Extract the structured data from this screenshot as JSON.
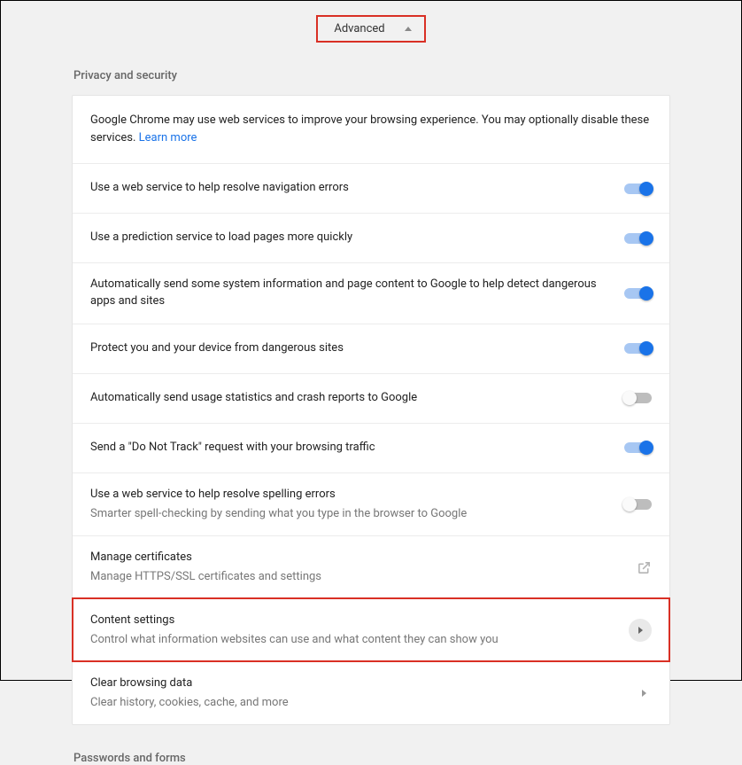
{
  "advanced_label": "Advanced",
  "section_privacy": "Privacy and security",
  "intro_text": "Google Chrome may use web services to improve your browsing experience. You may optionally disable these services. ",
  "intro_link": "Learn more",
  "rows": {
    "nav_errors": {
      "title": "Use a web service to help resolve navigation errors"
    },
    "prediction": {
      "title": "Use a prediction service to load pages more quickly"
    },
    "safe_content": {
      "title": "Automatically send some system information and page content to Google to help detect dangerous apps and sites"
    },
    "protect": {
      "title": "Protect you and your device from dangerous sites"
    },
    "usage_stats": {
      "title": "Automatically send usage statistics and crash reports to Google"
    },
    "dnt": {
      "title": "Send a \"Do Not Track\" request with your browsing traffic"
    },
    "spelling": {
      "title": "Use a web service to help resolve spelling errors",
      "sub": "Smarter spell-checking by sending what you type in the browser to Google"
    },
    "certs": {
      "title": "Manage certificates",
      "sub": "Manage HTTPS/SSL certificates and settings"
    },
    "content": {
      "title": "Content settings",
      "sub": "Control what information websites can use and what content they can show you"
    },
    "clear": {
      "title": "Clear browsing data",
      "sub": "Clear history, cookies, cache, and more"
    }
  },
  "section_passwords": "Passwords and forms"
}
